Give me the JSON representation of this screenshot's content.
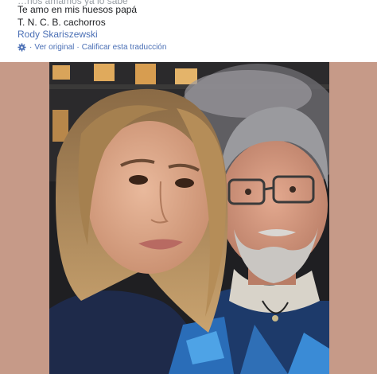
{
  "post": {
    "cut_line": "…nos amamos ya lo sabe",
    "line1": "Te amo en mis huesos papá",
    "line2": "T. N. C. B. cachorros",
    "author": "Rody Skariszewski",
    "see_original": "Ver original",
    "separator": "·",
    "rate_translation": "Calificar esta traducción"
  },
  "photo": {
    "alt": "Selfie of a smiling young woman with long blonde-brown hair next to an older man with grey hair, grey beard and glasses, standing in front of a lit building at night."
  },
  "colors": {
    "link": "#4a6fb5",
    "frame": "#c69a88",
    "text": "#1c1e21"
  }
}
